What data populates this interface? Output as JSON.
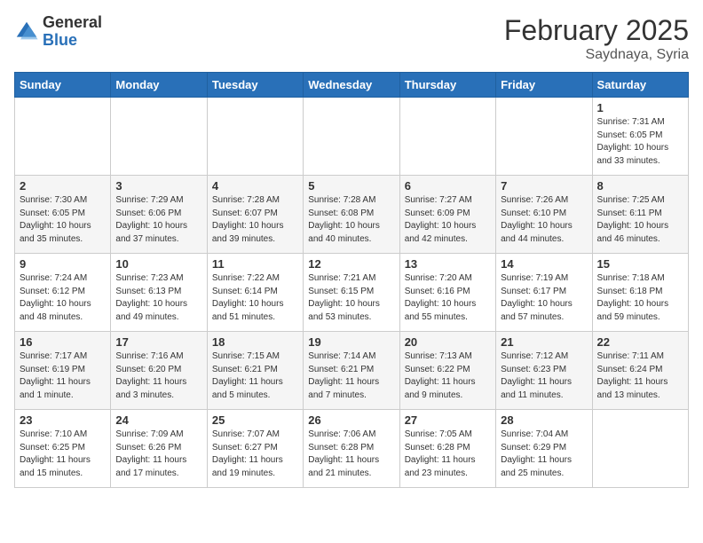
{
  "header": {
    "logo_general": "General",
    "logo_blue": "Blue",
    "title": "February 2025",
    "subtitle": "Saydnaya, Syria"
  },
  "weekdays": [
    "Sunday",
    "Monday",
    "Tuesday",
    "Wednesday",
    "Thursday",
    "Friday",
    "Saturday"
  ],
  "weeks": [
    [
      {
        "day": "",
        "info": ""
      },
      {
        "day": "",
        "info": ""
      },
      {
        "day": "",
        "info": ""
      },
      {
        "day": "",
        "info": ""
      },
      {
        "day": "",
        "info": ""
      },
      {
        "day": "",
        "info": ""
      },
      {
        "day": "1",
        "info": "Sunrise: 7:31 AM\nSunset: 6:05 PM\nDaylight: 10 hours and 33 minutes."
      }
    ],
    [
      {
        "day": "2",
        "info": "Sunrise: 7:30 AM\nSunset: 6:05 PM\nDaylight: 10 hours and 35 minutes."
      },
      {
        "day": "3",
        "info": "Sunrise: 7:29 AM\nSunset: 6:06 PM\nDaylight: 10 hours and 37 minutes."
      },
      {
        "day": "4",
        "info": "Sunrise: 7:28 AM\nSunset: 6:07 PM\nDaylight: 10 hours and 39 minutes."
      },
      {
        "day": "5",
        "info": "Sunrise: 7:28 AM\nSunset: 6:08 PM\nDaylight: 10 hours and 40 minutes."
      },
      {
        "day": "6",
        "info": "Sunrise: 7:27 AM\nSunset: 6:09 PM\nDaylight: 10 hours and 42 minutes."
      },
      {
        "day": "7",
        "info": "Sunrise: 7:26 AM\nSunset: 6:10 PM\nDaylight: 10 hours and 44 minutes."
      },
      {
        "day": "8",
        "info": "Sunrise: 7:25 AM\nSunset: 6:11 PM\nDaylight: 10 hours and 46 minutes."
      }
    ],
    [
      {
        "day": "9",
        "info": "Sunrise: 7:24 AM\nSunset: 6:12 PM\nDaylight: 10 hours and 48 minutes."
      },
      {
        "day": "10",
        "info": "Sunrise: 7:23 AM\nSunset: 6:13 PM\nDaylight: 10 hours and 49 minutes."
      },
      {
        "day": "11",
        "info": "Sunrise: 7:22 AM\nSunset: 6:14 PM\nDaylight: 10 hours and 51 minutes."
      },
      {
        "day": "12",
        "info": "Sunrise: 7:21 AM\nSunset: 6:15 PM\nDaylight: 10 hours and 53 minutes."
      },
      {
        "day": "13",
        "info": "Sunrise: 7:20 AM\nSunset: 6:16 PM\nDaylight: 10 hours and 55 minutes."
      },
      {
        "day": "14",
        "info": "Sunrise: 7:19 AM\nSunset: 6:17 PM\nDaylight: 10 hours and 57 minutes."
      },
      {
        "day": "15",
        "info": "Sunrise: 7:18 AM\nSunset: 6:18 PM\nDaylight: 10 hours and 59 minutes."
      }
    ],
    [
      {
        "day": "16",
        "info": "Sunrise: 7:17 AM\nSunset: 6:19 PM\nDaylight: 11 hours and 1 minute."
      },
      {
        "day": "17",
        "info": "Sunrise: 7:16 AM\nSunset: 6:20 PM\nDaylight: 11 hours and 3 minutes."
      },
      {
        "day": "18",
        "info": "Sunrise: 7:15 AM\nSunset: 6:21 PM\nDaylight: 11 hours and 5 minutes."
      },
      {
        "day": "19",
        "info": "Sunrise: 7:14 AM\nSunset: 6:21 PM\nDaylight: 11 hours and 7 minutes."
      },
      {
        "day": "20",
        "info": "Sunrise: 7:13 AM\nSunset: 6:22 PM\nDaylight: 11 hours and 9 minutes."
      },
      {
        "day": "21",
        "info": "Sunrise: 7:12 AM\nSunset: 6:23 PM\nDaylight: 11 hours and 11 minutes."
      },
      {
        "day": "22",
        "info": "Sunrise: 7:11 AM\nSunset: 6:24 PM\nDaylight: 11 hours and 13 minutes."
      }
    ],
    [
      {
        "day": "23",
        "info": "Sunrise: 7:10 AM\nSunset: 6:25 PM\nDaylight: 11 hours and 15 minutes."
      },
      {
        "day": "24",
        "info": "Sunrise: 7:09 AM\nSunset: 6:26 PM\nDaylight: 11 hours and 17 minutes."
      },
      {
        "day": "25",
        "info": "Sunrise: 7:07 AM\nSunset: 6:27 PM\nDaylight: 11 hours and 19 minutes."
      },
      {
        "day": "26",
        "info": "Sunrise: 7:06 AM\nSunset: 6:28 PM\nDaylight: 11 hours and 21 minutes."
      },
      {
        "day": "27",
        "info": "Sunrise: 7:05 AM\nSunset: 6:28 PM\nDaylight: 11 hours and 23 minutes."
      },
      {
        "day": "28",
        "info": "Sunrise: 7:04 AM\nSunset: 6:29 PM\nDaylight: 11 hours and 25 minutes."
      },
      {
        "day": "",
        "info": ""
      }
    ]
  ]
}
